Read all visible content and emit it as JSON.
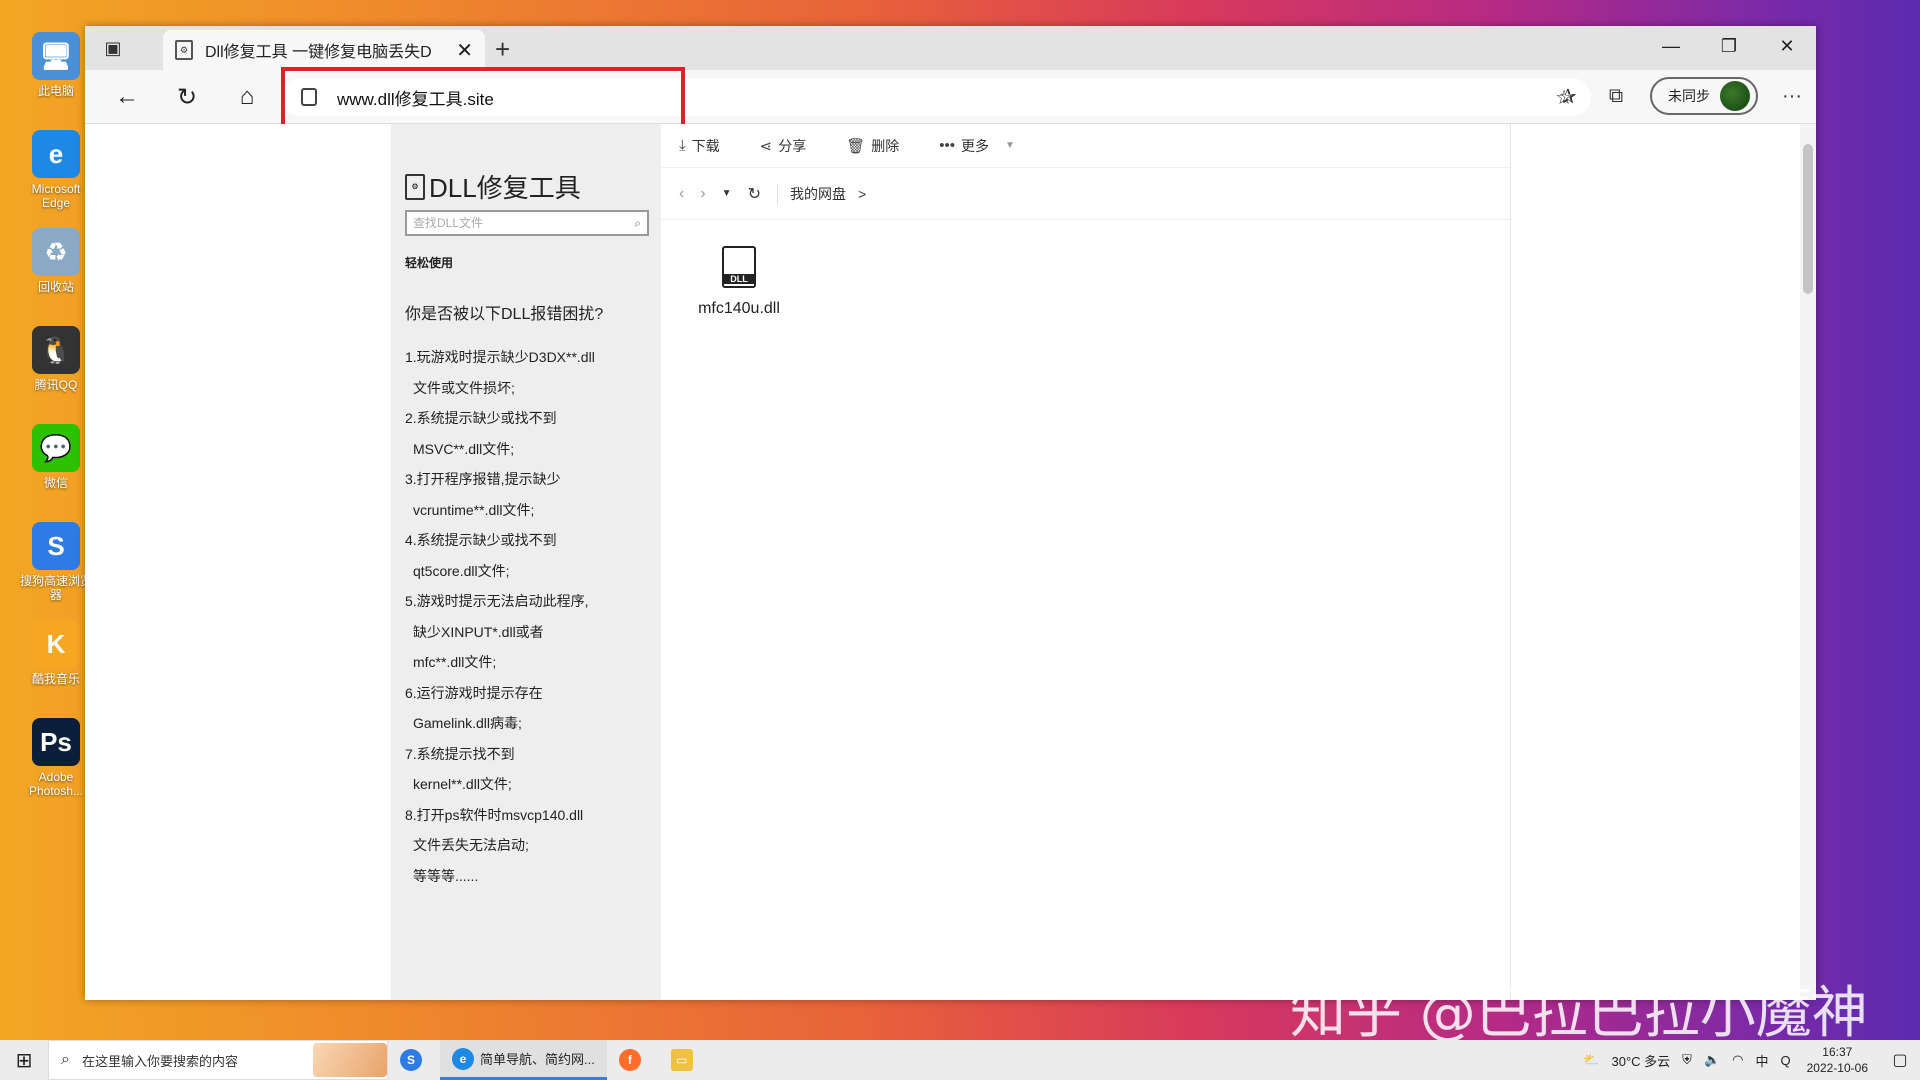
{
  "desktop": {
    "icons": [
      {
        "label": "此电脑",
        "icon": "computer-icon",
        "glyph": "🖥",
        "color": "#4a90d9"
      },
      {
        "label": "Microsoft Edge",
        "icon": "edge-icon",
        "glyph": "e",
        "color": "#1e88e5"
      },
      {
        "label": "回收站",
        "icon": "recycle-bin-icon",
        "glyph": "♻",
        "color": "#8aa9c6"
      },
      {
        "label": "腾讯QQ",
        "icon": "qq-icon",
        "glyph": "🐧",
        "color": "#333333"
      },
      {
        "label": "微信",
        "icon": "wechat-icon",
        "glyph": "💬",
        "color": "#2dc100"
      },
      {
        "label": "搜狗高速浏览器",
        "icon": "sogou-browser-icon",
        "glyph": "S",
        "color": "#2f7be5"
      },
      {
        "label": "酷我音乐",
        "icon": "kuwo-music-icon",
        "glyph": "K",
        "color": "#f5a623"
      },
      {
        "label": "Adobe Photosh...",
        "icon": "photoshop-icon",
        "glyph": "Ps",
        "color": "#0b1f3a"
      }
    ]
  },
  "browser": {
    "tab_title": "Dll修复工具 一键修复电脑丢失D",
    "tab_close": "✕",
    "new_tab": "+",
    "window_controls": [
      "—",
      "❐",
      "✕"
    ],
    "address": "www.dll修复工具.site",
    "sync_label": "未同步",
    "more": "···"
  },
  "page": {
    "brand": "DLL修复工具",
    "search_placeholder": "查找DLL文件",
    "easy_use": "轻松使用",
    "question": "你是否被以下DLL报错困扰?",
    "issues": [
      {
        "line1": "1.玩游戏时提示缺少D3DX**.dll",
        "line2": "文件或文件损坏;"
      },
      {
        "line1": "2.系统提示缺少或找不到",
        "line2": "MSVC**.dll文件;"
      },
      {
        "line1": "3.打开程序报错,提示缺少",
        "line2": "vcruntime**.dll文件;"
      },
      {
        "line1": "4.系统提示缺少或找不到",
        "line2": "qt5core.dll文件;"
      },
      {
        "line1": "5.游戏时提示无法启动此程序,",
        "line2": "缺少XINPUT*.dll或者",
        "line3": "mfc**.dll文件;"
      },
      {
        "line1": "6.运行游戏时提示存在",
        "line2": "Gamelink.dll病毒;"
      },
      {
        "line1": "7.系统提示找不到",
        "line2": "kernel**.dll文件;"
      },
      {
        "line1": "8.打开ps软件时msvcp140.dll",
        "line2": "文件丢失无法启动;"
      },
      {
        "line1": "",
        "line2": "等等等......"
      }
    ],
    "toolbar": {
      "download": "下载",
      "share": "分享",
      "delete": "删除",
      "more": "更多"
    },
    "breadcrumb": {
      "root": "我的网盘",
      "sep": ">"
    },
    "file": {
      "name": "mfc140u.dll",
      "tag": "DLL"
    }
  },
  "watermark": "知乎 @巴拉巴拉小魔神",
  "taskbar": {
    "search_placeholder": "在这里输入你要搜索的内容",
    "app_edge_label": "简单导航、简约网...",
    "weather": "30°C 多云",
    "time": "16:37",
    "date": "2022-10-06"
  },
  "colors": {
    "highlight": "#e0202a",
    "accent": "#3a7bd5"
  }
}
